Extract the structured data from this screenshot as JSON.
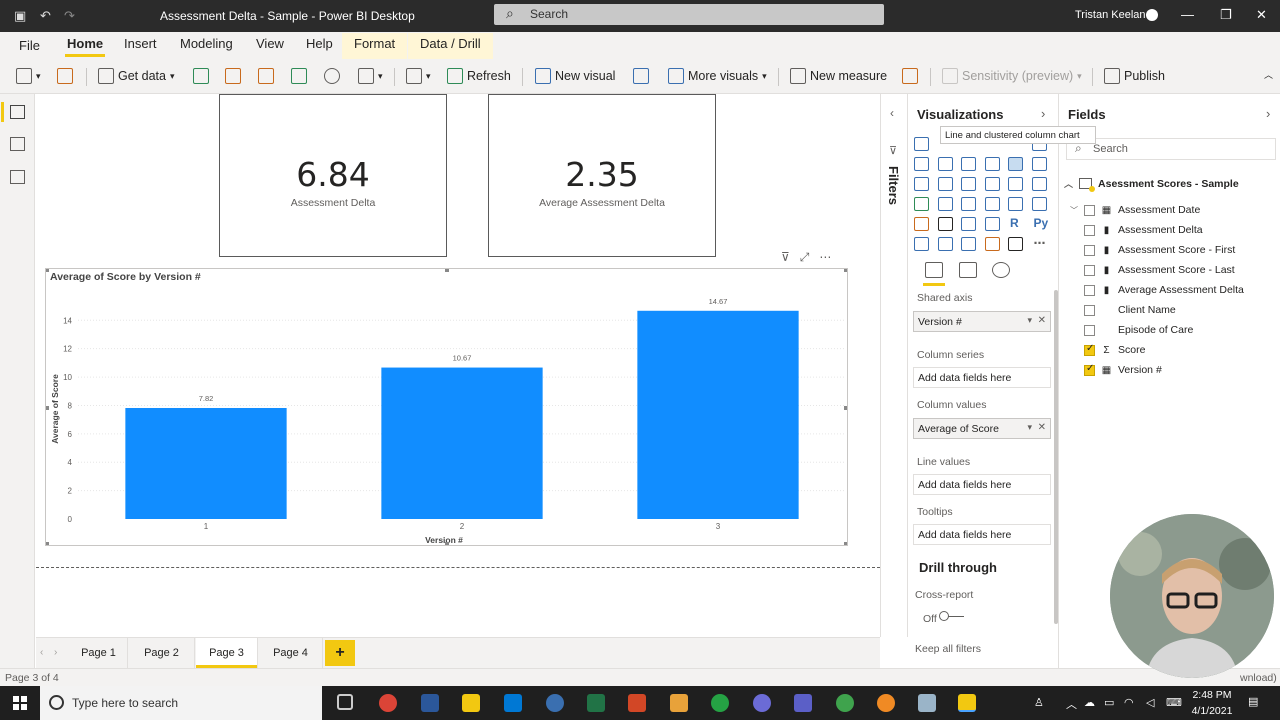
{
  "window": {
    "title": "Assessment Delta - Sample - Power BI Desktop",
    "search_placeholder": "Search",
    "user": "Tristan Keelan"
  },
  "menu": [
    "File",
    "Home",
    "Insert",
    "Modeling",
    "View",
    "Help",
    "Format",
    "Data / Drill"
  ],
  "ribbon": {
    "get_data": "Get data",
    "refresh": "Refresh",
    "new_visual": "New visual",
    "more_visuals": "More visuals",
    "new_measure": "New measure",
    "sensitivity": "Sensitivity (preview)",
    "publish": "Publish"
  },
  "cards": [
    {
      "value": "6.84",
      "label": "Assessment Delta"
    },
    {
      "value": "2.35",
      "label": "Average Assessment Delta"
    }
  ],
  "chart_data": {
    "type": "bar",
    "title": "Average of Score by Version #",
    "xlabel": "Version #",
    "ylabel": "Average of Score",
    "categories": [
      "1",
      "2",
      "3"
    ],
    "values": [
      7.82,
      10.67,
      14.67
    ],
    "data_labels": [
      "7.82",
      "10.67",
      "14.67"
    ],
    "yticks": [
      "0",
      "2",
      "4",
      "6",
      "8",
      "10",
      "12",
      "14"
    ],
    "ylim": [
      0,
      15.5
    ],
    "bar_color": "#118dff",
    "grid": true
  },
  "pages": {
    "tabs": [
      "Page 1",
      "Page 2",
      "Page 3",
      "Page 4"
    ],
    "active": "Page 3",
    "add_label": "+"
  },
  "status": {
    "page_count": "Page 3 of 4",
    "right_text": "wnload)"
  },
  "filters": {
    "label": "Filters"
  },
  "visualizations": {
    "title": "Visualizations",
    "tooltip": "Line and clustered column chart",
    "wells": {
      "shared_axis_label": "Shared axis",
      "shared_axis_value": "Version #",
      "column_series_label": "Column series",
      "column_values_label": "Column values",
      "column_values_value": "Average of Score",
      "line_values_label": "Line values",
      "tooltips_label": "Tooltips",
      "placeholder": "Add data fields here"
    },
    "drill_through": "Drill through",
    "cross_report": "Cross-report",
    "toggle_state": "Off",
    "keep_all_filters": "Keep all filters"
  },
  "fields": {
    "title": "Fields",
    "search_placeholder": "Search",
    "table_name": "Asessment Scores - Sample",
    "items": [
      {
        "name": "Assessment Date",
        "checked": false,
        "type": "date"
      },
      {
        "name": "Assessment Delta",
        "checked": false,
        "type": "calc"
      },
      {
        "name": "Assessment Score - First",
        "checked": false,
        "type": "calc"
      },
      {
        "name": "Assessment Score - Last",
        "checked": false,
        "type": "calc"
      },
      {
        "name": "Average Assessment Delta",
        "checked": false,
        "type": "calc"
      },
      {
        "name": "Client Name",
        "checked": false,
        "type": "text"
      },
      {
        "name": "Episode of Care",
        "checked": false,
        "type": "text"
      },
      {
        "name": "Score",
        "checked": true,
        "type": "sum"
      },
      {
        "name": "Version #",
        "checked": true,
        "type": "table"
      }
    ]
  },
  "taskbar": {
    "search_placeholder": "Type here to search",
    "time": "2:48 PM",
    "date": "4/1/2021"
  },
  "colors": {
    "accent": "#f2c811",
    "bar": "#118dff"
  }
}
